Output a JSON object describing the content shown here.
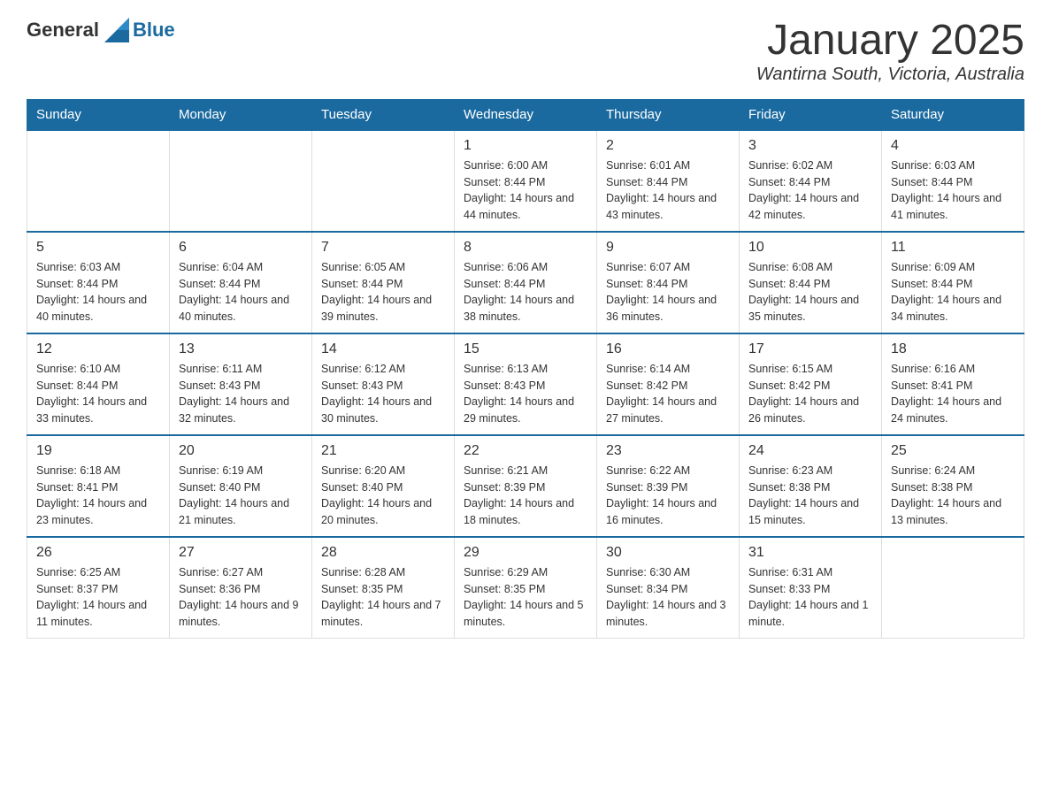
{
  "header": {
    "logo_general": "General",
    "logo_blue": "Blue",
    "month_title": "January 2025",
    "location": "Wantirna South, Victoria, Australia"
  },
  "days_of_week": [
    "Sunday",
    "Monday",
    "Tuesday",
    "Wednesday",
    "Thursday",
    "Friday",
    "Saturday"
  ],
  "weeks": [
    {
      "days": [
        {
          "number": "",
          "info": ""
        },
        {
          "number": "",
          "info": ""
        },
        {
          "number": "",
          "info": ""
        },
        {
          "number": "1",
          "info": "Sunrise: 6:00 AM\nSunset: 8:44 PM\nDaylight: 14 hours and 44 minutes."
        },
        {
          "number": "2",
          "info": "Sunrise: 6:01 AM\nSunset: 8:44 PM\nDaylight: 14 hours and 43 minutes."
        },
        {
          "number": "3",
          "info": "Sunrise: 6:02 AM\nSunset: 8:44 PM\nDaylight: 14 hours and 42 minutes."
        },
        {
          "number": "4",
          "info": "Sunrise: 6:03 AM\nSunset: 8:44 PM\nDaylight: 14 hours and 41 minutes."
        }
      ]
    },
    {
      "days": [
        {
          "number": "5",
          "info": "Sunrise: 6:03 AM\nSunset: 8:44 PM\nDaylight: 14 hours and 40 minutes."
        },
        {
          "number": "6",
          "info": "Sunrise: 6:04 AM\nSunset: 8:44 PM\nDaylight: 14 hours and 40 minutes."
        },
        {
          "number": "7",
          "info": "Sunrise: 6:05 AM\nSunset: 8:44 PM\nDaylight: 14 hours and 39 minutes."
        },
        {
          "number": "8",
          "info": "Sunrise: 6:06 AM\nSunset: 8:44 PM\nDaylight: 14 hours and 38 minutes."
        },
        {
          "number": "9",
          "info": "Sunrise: 6:07 AM\nSunset: 8:44 PM\nDaylight: 14 hours and 36 minutes."
        },
        {
          "number": "10",
          "info": "Sunrise: 6:08 AM\nSunset: 8:44 PM\nDaylight: 14 hours and 35 minutes."
        },
        {
          "number": "11",
          "info": "Sunrise: 6:09 AM\nSunset: 8:44 PM\nDaylight: 14 hours and 34 minutes."
        }
      ]
    },
    {
      "days": [
        {
          "number": "12",
          "info": "Sunrise: 6:10 AM\nSunset: 8:44 PM\nDaylight: 14 hours and 33 minutes."
        },
        {
          "number": "13",
          "info": "Sunrise: 6:11 AM\nSunset: 8:43 PM\nDaylight: 14 hours and 32 minutes."
        },
        {
          "number": "14",
          "info": "Sunrise: 6:12 AM\nSunset: 8:43 PM\nDaylight: 14 hours and 30 minutes."
        },
        {
          "number": "15",
          "info": "Sunrise: 6:13 AM\nSunset: 8:43 PM\nDaylight: 14 hours and 29 minutes."
        },
        {
          "number": "16",
          "info": "Sunrise: 6:14 AM\nSunset: 8:42 PM\nDaylight: 14 hours and 27 minutes."
        },
        {
          "number": "17",
          "info": "Sunrise: 6:15 AM\nSunset: 8:42 PM\nDaylight: 14 hours and 26 minutes."
        },
        {
          "number": "18",
          "info": "Sunrise: 6:16 AM\nSunset: 8:41 PM\nDaylight: 14 hours and 24 minutes."
        }
      ]
    },
    {
      "days": [
        {
          "number": "19",
          "info": "Sunrise: 6:18 AM\nSunset: 8:41 PM\nDaylight: 14 hours and 23 minutes."
        },
        {
          "number": "20",
          "info": "Sunrise: 6:19 AM\nSunset: 8:40 PM\nDaylight: 14 hours and 21 minutes."
        },
        {
          "number": "21",
          "info": "Sunrise: 6:20 AM\nSunset: 8:40 PM\nDaylight: 14 hours and 20 minutes."
        },
        {
          "number": "22",
          "info": "Sunrise: 6:21 AM\nSunset: 8:39 PM\nDaylight: 14 hours and 18 minutes."
        },
        {
          "number": "23",
          "info": "Sunrise: 6:22 AM\nSunset: 8:39 PM\nDaylight: 14 hours and 16 minutes."
        },
        {
          "number": "24",
          "info": "Sunrise: 6:23 AM\nSunset: 8:38 PM\nDaylight: 14 hours and 15 minutes."
        },
        {
          "number": "25",
          "info": "Sunrise: 6:24 AM\nSunset: 8:38 PM\nDaylight: 14 hours and 13 minutes."
        }
      ]
    },
    {
      "days": [
        {
          "number": "26",
          "info": "Sunrise: 6:25 AM\nSunset: 8:37 PM\nDaylight: 14 hours and 11 minutes."
        },
        {
          "number": "27",
          "info": "Sunrise: 6:27 AM\nSunset: 8:36 PM\nDaylight: 14 hours and 9 minutes."
        },
        {
          "number": "28",
          "info": "Sunrise: 6:28 AM\nSunset: 8:35 PM\nDaylight: 14 hours and 7 minutes."
        },
        {
          "number": "29",
          "info": "Sunrise: 6:29 AM\nSunset: 8:35 PM\nDaylight: 14 hours and 5 minutes."
        },
        {
          "number": "30",
          "info": "Sunrise: 6:30 AM\nSunset: 8:34 PM\nDaylight: 14 hours and 3 minutes."
        },
        {
          "number": "31",
          "info": "Sunrise: 6:31 AM\nSunset: 8:33 PM\nDaylight: 14 hours and 1 minute."
        },
        {
          "number": "",
          "info": ""
        }
      ]
    }
  ]
}
